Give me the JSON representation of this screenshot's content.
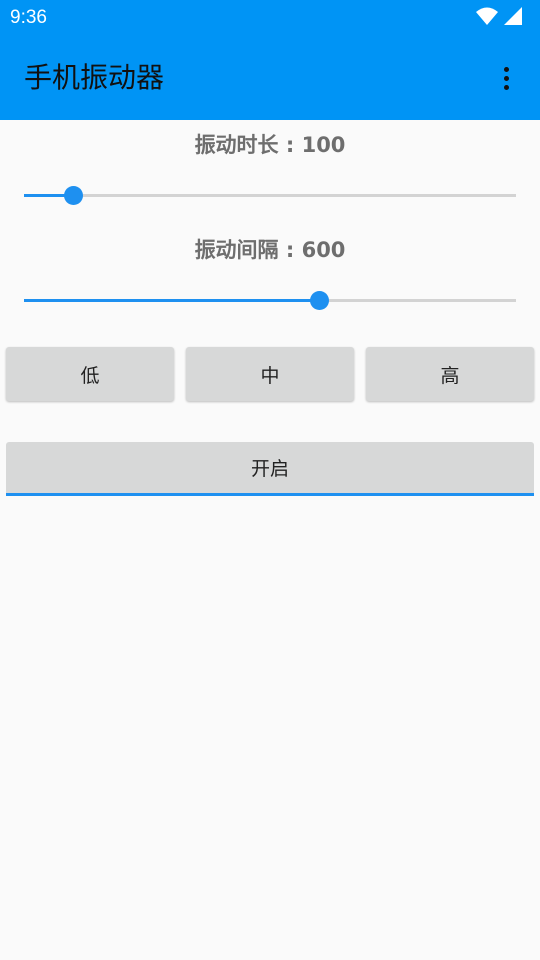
{
  "status_bar": {
    "time": "9:36",
    "icons": [
      "wifi-icon",
      "cellular-signal-icon"
    ]
  },
  "app_bar": {
    "title": "手机振动器",
    "menu_icon": "more-vert-icon"
  },
  "duration": {
    "label": "振动时长 : 100",
    "value": 100,
    "fraction": 0.1
  },
  "interval": {
    "label": "振动间隔 : 600",
    "value": 600,
    "fraction": 0.6
  },
  "levels": {
    "low": "低",
    "mid": "中",
    "high": "高"
  },
  "start_button": "开启",
  "colors": {
    "primary": "#0094f5",
    "accent": "#1e90f0",
    "background": "#fafafa",
    "button": "#d7d8d8"
  }
}
